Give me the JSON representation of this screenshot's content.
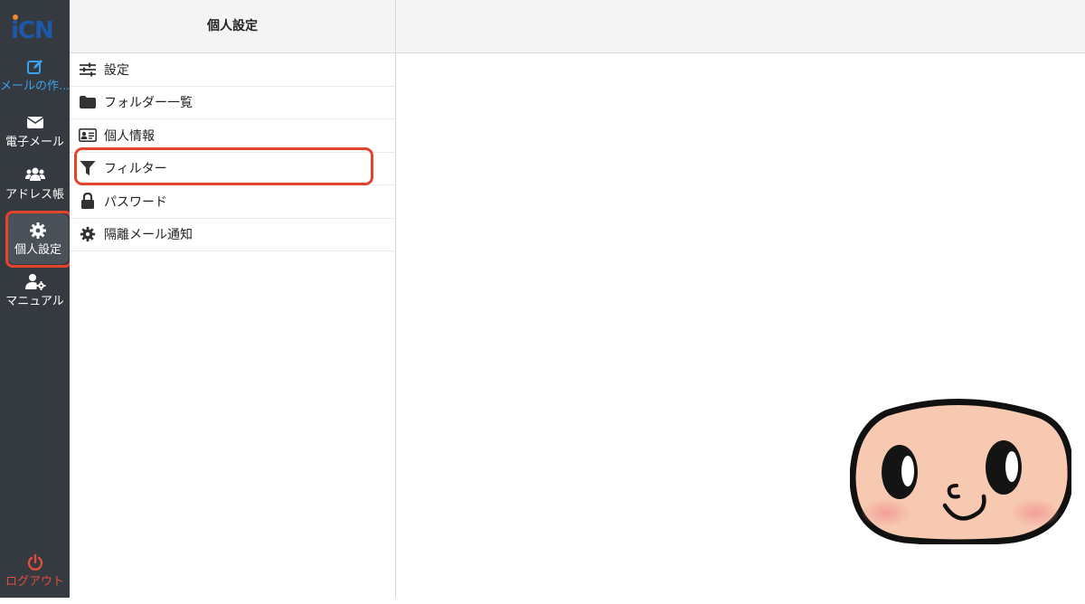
{
  "app": {
    "logo_text": "iCN"
  },
  "nav": {
    "items": [
      {
        "label": "メールの作...",
        "icon": "compose-icon"
      },
      {
        "label": "電子メール",
        "icon": "envelope-icon"
      },
      {
        "label": "アドレス帳",
        "icon": "users-icon"
      },
      {
        "label": "個人設定",
        "icon": "gear-icon"
      },
      {
        "label": "マニュアル",
        "icon": "user-gear-icon"
      }
    ],
    "logout_label": "ログアウト"
  },
  "settings_panel": {
    "title": "個人設定",
    "items": [
      {
        "label": "設定",
        "icon": "sliders-icon"
      },
      {
        "label": "フォルダー一覧",
        "icon": "folder-icon"
      },
      {
        "label": "個人情報",
        "icon": "id-card-icon"
      },
      {
        "label": "フィルター",
        "icon": "filter-icon"
      },
      {
        "label": "パスワード",
        "icon": "lock-icon"
      },
      {
        "label": "隔離メール通知",
        "icon": "gear-icon"
      }
    ]
  },
  "colors": {
    "nav_bg": "#343a40",
    "accent": "#3aa3f0",
    "highlight": "#e3442b",
    "logout": "#e24c3c"
  }
}
